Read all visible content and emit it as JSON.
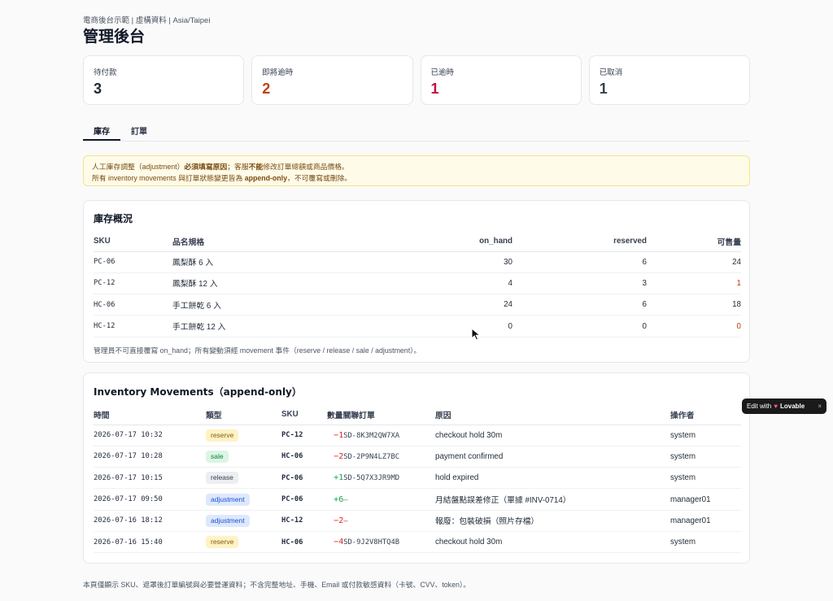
{
  "header": {
    "meta": "電商後台示範 | 虛構資料 | Asia/Taipei",
    "title": "管理後台"
  },
  "cards": [
    {
      "label": "待付款",
      "value": "3",
      "color": "#1f2937"
    },
    {
      "label": "即將逾時",
      "value": "2",
      "color": "#c2410c"
    },
    {
      "label": "已逾時",
      "value": "1",
      "color": "#be123c"
    },
    {
      "label": "已取消",
      "value": "1",
      "color": "#374151"
    }
  ],
  "tabs": [
    {
      "label": "庫存"
    },
    {
      "label": "訂單"
    }
  ],
  "notice": {
    "line1_pre": "人工庫存調整（adjustment）",
    "line1_bold": "必須填寫原因",
    "line1_mid": "；客服",
    "line1_bold2": "不能",
    "line1_post": "修改訂單總額或商品價格。",
    "line2_pre": "所有 inventory movements 與訂單狀態變更皆為 ",
    "line2_bold": "append-only",
    "line2_post": "，不可覆寫或刪除。"
  },
  "inventory": {
    "title": "庫存概況",
    "headers": {
      "sku": "SKU",
      "name": "品名規格",
      "on_hand": "on_hand",
      "reserved": "reserved",
      "available": "可售量"
    },
    "rows": [
      {
        "sku": "PC-06",
        "name": "鳳梨酥 6 入",
        "on_hand": "30",
        "reserved": "6",
        "available": "24",
        "avail_color": "#1f2937"
      },
      {
        "sku": "PC-12",
        "name": "鳳梨酥 12 入",
        "on_hand": "4",
        "reserved": "3",
        "available": "1",
        "avail_color": "#c2410c"
      },
      {
        "sku": "HC-06",
        "name": "手工餅乾 6 入",
        "on_hand": "24",
        "reserved": "6",
        "available": "18",
        "avail_color": "#1f2937"
      },
      {
        "sku": "HC-12",
        "name": "手工餅乾 12 入",
        "on_hand": "0",
        "reserved": "0",
        "available": "0",
        "avail_color": "#c2410c"
      }
    ],
    "footnote": "管理員不可直接覆寫 on_hand；所有變動須經 movement 事件（reserve / release / sale / adjustment）。"
  },
  "movements": {
    "title": "Inventory Movements（append-only）",
    "headers": {
      "time": "時間",
      "type": "類型",
      "sku": "SKU",
      "qty": "數量關聯訂單",
      "reason": "原因",
      "operator": "操作者"
    },
    "rows": [
      {
        "time": "2026-07-17 10:32",
        "type": "reserve",
        "type_bg": "#fdf3c4",
        "type_fg": "#8a5a12",
        "sku": "PC-12",
        "qty": "−1",
        "qty_color": "#dc2626",
        "order": "SD-8K3M2QW7XA",
        "reason": "checkout hold 30m",
        "operator": "system"
      },
      {
        "time": "2026-07-17 10:28",
        "type": "sale",
        "type_bg": "#dcf5e5",
        "type_fg": "#15803d",
        "sku": "HC-06",
        "qty": "−2",
        "qty_color": "#dc2626",
        "order": "SD-2P9N4LZ7BC",
        "reason": "payment confirmed",
        "operator": "system"
      },
      {
        "time": "2026-07-17 10:15",
        "type": "release",
        "type_bg": "#eceef1",
        "type_fg": "#374151",
        "sku": "PC-06",
        "qty": "+1",
        "qty_color": "#16a34a",
        "order": "SD-5Q7X3JR9MD",
        "reason": "hold expired",
        "operator": "system"
      },
      {
        "time": "2026-07-17 09:50",
        "type": "adjustment",
        "type_bg": "#dde9fb",
        "type_fg": "#1d4ed8",
        "sku": "PC-06",
        "qty": "+6",
        "qty_color": "#16a34a",
        "order": "—",
        "reason": "月結盤點誤差修正（單據 #INV-0714）",
        "operator": "manager01"
      },
      {
        "time": "2026-07-16 18:12",
        "type": "adjustment",
        "type_bg": "#dde9fb",
        "type_fg": "#1d4ed8",
        "sku": "HC-12",
        "qty": "−2",
        "qty_color": "#dc2626",
        "order": "—",
        "reason": "報廢：包裝破損（照片存檔）",
        "operator": "manager01"
      },
      {
        "time": "2026-07-16 15:40",
        "type": "reserve",
        "type_bg": "#fdf3c4",
        "type_fg": "#8a5a12",
        "sku": "HC-06",
        "qty": "−4",
        "qty_color": "#dc2626",
        "order": "SD-9J2V8HTQ4B",
        "reason": "checkout hold 30m",
        "operator": "system"
      }
    ]
  },
  "footer": "本頁僅顯示 SKU、遮罩後訂單編號與必要營運資料；不含完整地址、手機、Email 或付款敏感資料（卡號、CVV、token）。",
  "lovable": {
    "pre": "Edit with",
    "brand": "Lovable",
    "close": "×"
  }
}
